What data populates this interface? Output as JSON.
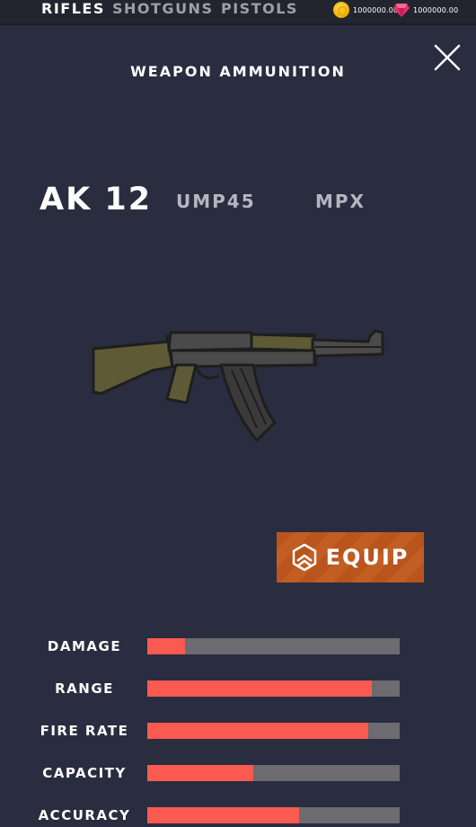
{
  "categories": [
    {
      "label": "RIFLES",
      "active": true
    },
    {
      "label": "SHOTGUNS",
      "active": false
    },
    {
      "label": "PISTOLS",
      "active": false
    }
  ],
  "currency": {
    "coins": "1000000.00",
    "gems": "1000000.00",
    "coin_icon": "gold-coin-icon",
    "gem_icon": "pink-gem-icon"
  },
  "panel": {
    "title": "WEAPON AMMUNITION",
    "close_icon": "close-icon"
  },
  "weapons": [
    {
      "label": "AK 12",
      "selected": true
    },
    {
      "label": "UMP45",
      "selected": false
    },
    {
      "label": "MPX",
      "selected": false
    }
  ],
  "equip": {
    "label": "EQUIP",
    "icon": "rank-chevron-icon",
    "color": "#b8541c"
  },
  "stats": [
    {
      "label": "DAMAGE",
      "value": 0.15
    },
    {
      "label": "RANGE",
      "value": 0.89
    },
    {
      "label": "FIRE RATE",
      "value": 0.875
    },
    {
      "label": "CAPACITY",
      "value": 0.42
    },
    {
      "label": "ACCURACY",
      "value": 0.6
    }
  ],
  "colors": {
    "background": "#2a2d3f",
    "stat_fill": "#fa5a50",
    "stat_track": "#6b6b70"
  }
}
